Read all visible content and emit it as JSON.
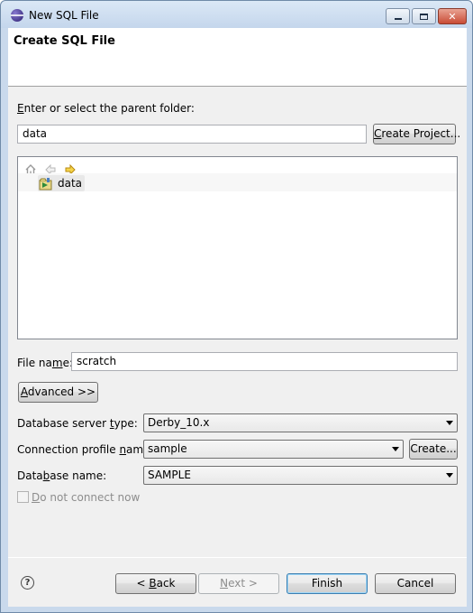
{
  "window": {
    "title": "New SQL File"
  },
  "header": {
    "title": "Create SQL File"
  },
  "parent_folder": {
    "label_prefix": "",
    "label_mnemonic": "E",
    "label_rest": "nter or select the parent folder:",
    "value": "data",
    "create_project_mnemonic": "C",
    "create_project_rest": "reate Project..."
  },
  "tree": {
    "items": [
      {
        "label": "data",
        "icon": "project-folder-icon"
      }
    ]
  },
  "file_name": {
    "label_start": "File na",
    "label_mnemonic": "m",
    "label_end": "e:",
    "value": "scratch"
  },
  "advanced_button": {
    "mnemonic": "A",
    "rest": "dvanced >>"
  },
  "db_server_type": {
    "label_start": "Database server ",
    "label_mnemonic": "t",
    "label_end": "ype:",
    "value": "Derby_10.x"
  },
  "connection_profile": {
    "label_start": "Connection profile ",
    "label_mnemonic": "n",
    "label_end": "ame:",
    "value": "sample",
    "create_label": "Create..."
  },
  "database_name": {
    "label_start": "Data",
    "label_mnemonic": "b",
    "label_end": "ase name:",
    "value": "SAMPLE"
  },
  "do_not_connect": {
    "mnemonic": "D",
    "rest": "o not connect now"
  },
  "footer": {
    "help": "?",
    "back_prefix": "< ",
    "back_mnemonic": "B",
    "back_rest": "ack",
    "next_mnemonic": "N",
    "next_rest": "ext >",
    "finish": "Finish",
    "cancel": "Cancel"
  }
}
